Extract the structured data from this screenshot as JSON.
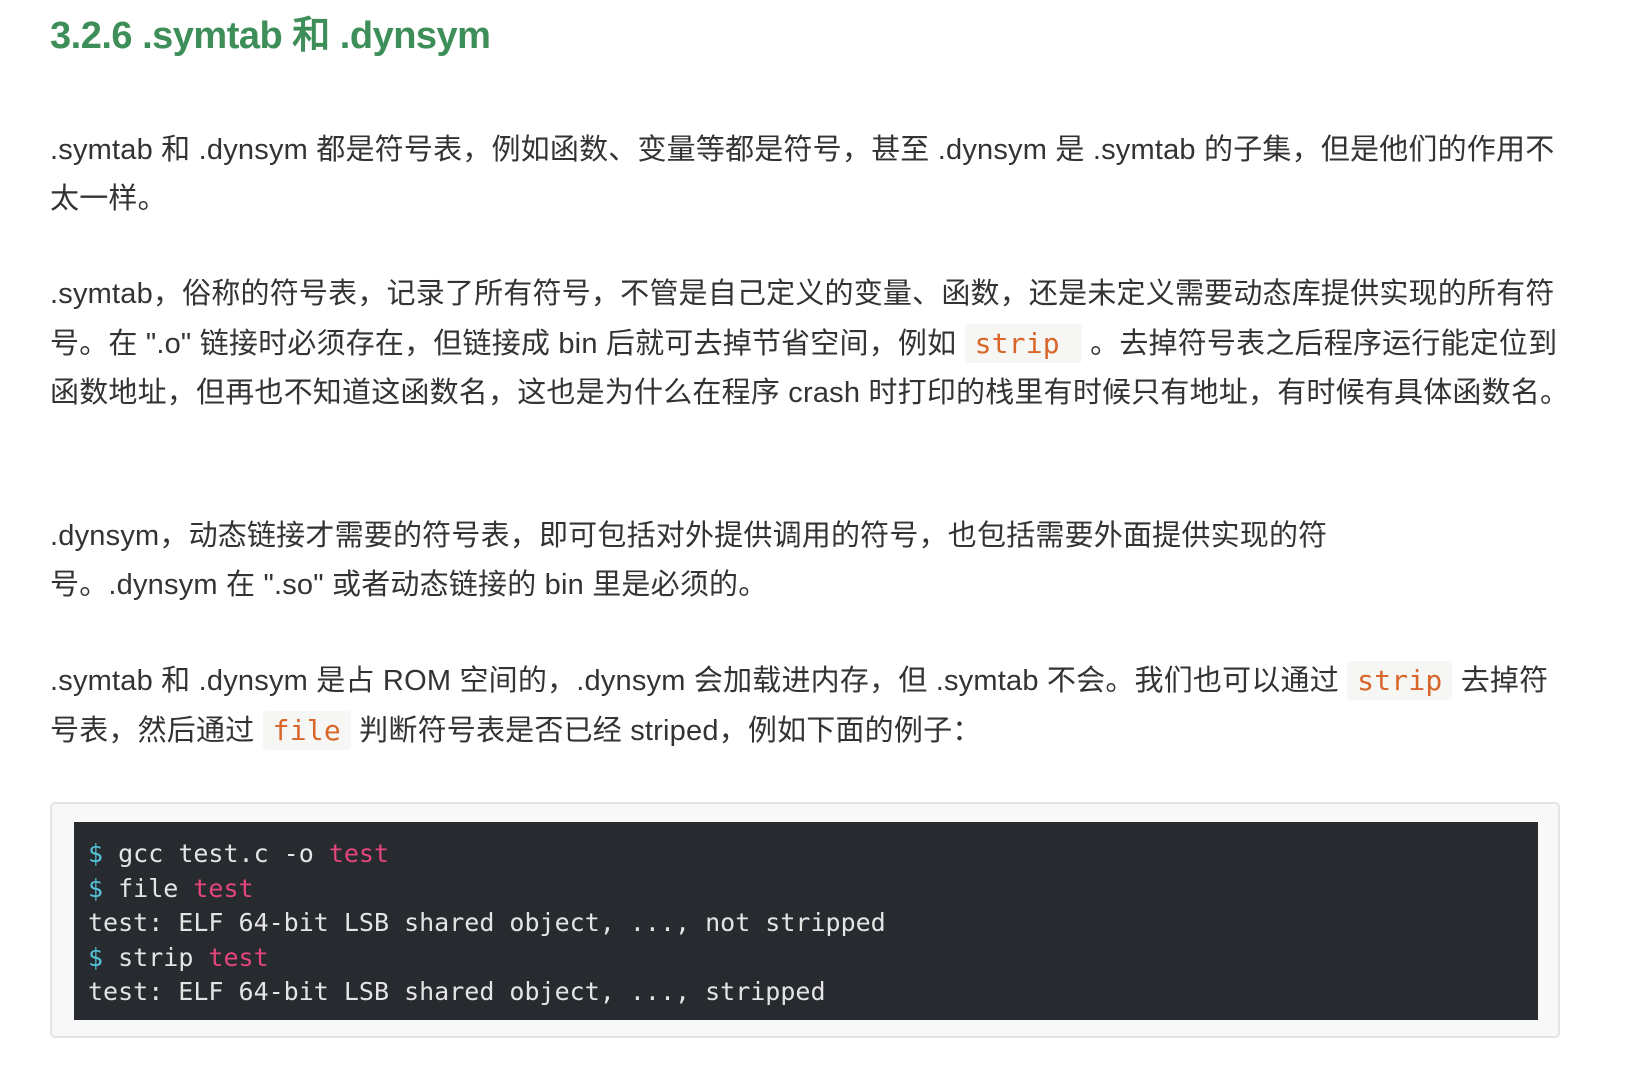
{
  "heading": "3.2.6 .symtab 和 .dynsym",
  "paragraphs": {
    "p1": ".symtab 和 .dynsym 都是符号表，例如函数、变量等都是符号，甚至 .dynsym 是 .symtab 的子集，但是他们的作用不太一样。",
    "p2_before_code": ".symtab，俗称的符号表，记录了所有符号，不管是自己定义的变量、函数，还是未定义需要动态库提供实现的所有符号。在 \".o\" 链接时必须存在，但链接成 bin 后就可去掉节省空间，例如 ",
    "p2_code": "strip",
    "p2_after_code": " 。去掉符号表之后程序运行能定位到函数地址，但再也不知道这函数名，这也是为什么在程序 crash 时打印的栈里有时候只有地址，有时候有具体函数名。",
    "p3": ".dynsym，动态链接才需要的符号表，即可包括对外提供调用的符号，也包括需要外面提供实现的符号。.dynsym 在 \".so\" 或者动态链接的 bin 里是必须的。",
    "p4_part1": ".symtab 和 .dynsym 是占 ROM 空间的，.dynsym 会加载进内存，但 .symtab 不会。我们也可以通过 ",
    "p4_code1": "strip",
    "p4_part2": " 去掉符号表，然后通过 ",
    "p4_code2": "file",
    "p4_part3": " 判断符号表是否已经 striped，例如下面的例子："
  },
  "code_block": {
    "lines": [
      {
        "prompt": "$ ",
        "cmd": "gcc test.c -o ",
        "arg": "test"
      },
      {
        "prompt": "$ ",
        "cmd": "file ",
        "arg": "test"
      },
      {
        "output": "test: ELF 64-bit LSB shared object, ..., not stripped"
      },
      {
        "prompt": "$ ",
        "cmd": "strip ",
        "arg": "test"
      },
      {
        "output": "test: ELF 64-bit LSB shared object, ..., stripped"
      }
    ]
  },
  "colors": {
    "heading": "#3e8e5a",
    "body_text": "#333333",
    "inline_code": "#d9662a",
    "code_bg": "#272a2e",
    "prompt": "#56c1d8",
    "arg": "#e4467a"
  }
}
